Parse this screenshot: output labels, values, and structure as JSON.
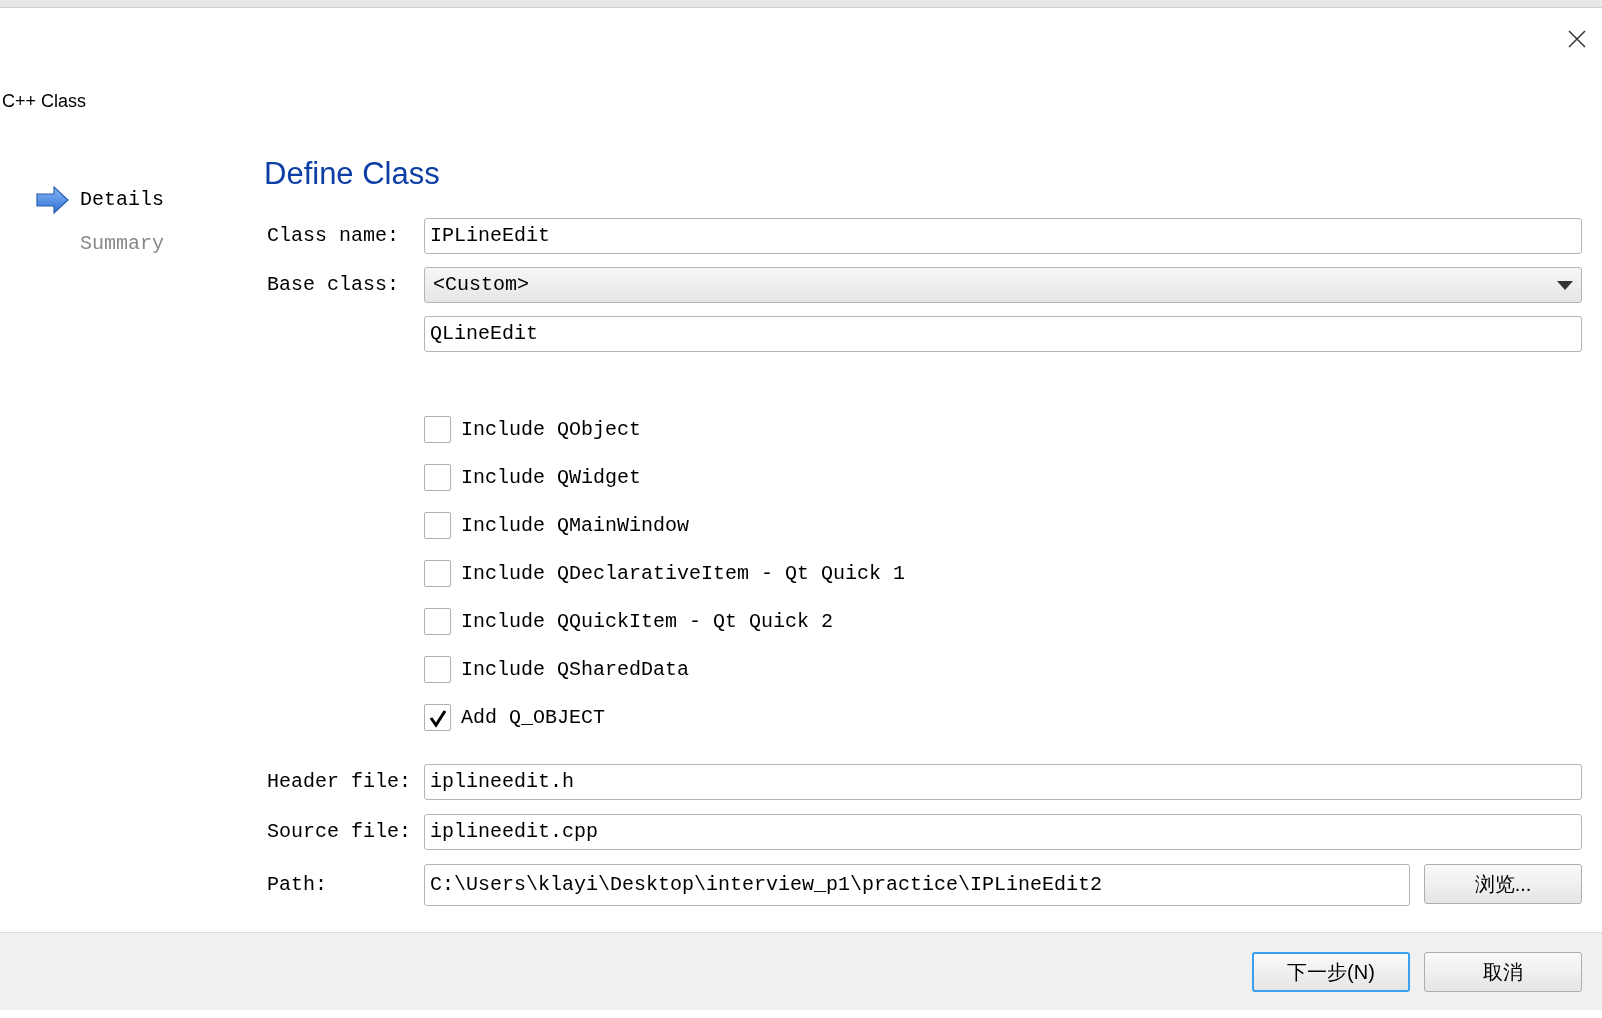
{
  "window": {
    "title": "C++ Class"
  },
  "steps": [
    {
      "label": "Details",
      "selected": true
    },
    {
      "label": "Summary",
      "selected": false
    }
  ],
  "page_title": "Define Class",
  "class_name": {
    "label": "Class name:",
    "value": "IPLineEdit"
  },
  "base_class": {
    "label": "Base class:",
    "value": "<Custom>",
    "custom_value": "QLineEdit"
  },
  "options": [
    {
      "label": "Include QObject",
      "checked": false
    },
    {
      "label": "Include QWidget",
      "checked": false
    },
    {
      "label": "Include QMainWindow",
      "checked": false
    },
    {
      "label": "Include QDeclarativeItem - Qt Quick 1",
      "checked": false
    },
    {
      "label": "Include QQuickItem - Qt Quick 2",
      "checked": false
    },
    {
      "label": "Include QSharedData",
      "checked": false
    },
    {
      "label": "Add Q_OBJECT",
      "checked": true
    }
  ],
  "header_file": {
    "label": "Header file:",
    "value": "iplineedit.h"
  },
  "source_file": {
    "label": "Source file:",
    "value": "iplineedit.cpp"
  },
  "path": {
    "label": "Path:",
    "value": "C:\\Users\\klayi\\Desktop\\interview_p1\\practice\\IPLineEdit2",
    "browse": "浏览..."
  },
  "buttons": [
    {
      "label": "下一步(N)",
      "default": true
    },
    {
      "label": "取消",
      "default": false
    }
  ]
}
